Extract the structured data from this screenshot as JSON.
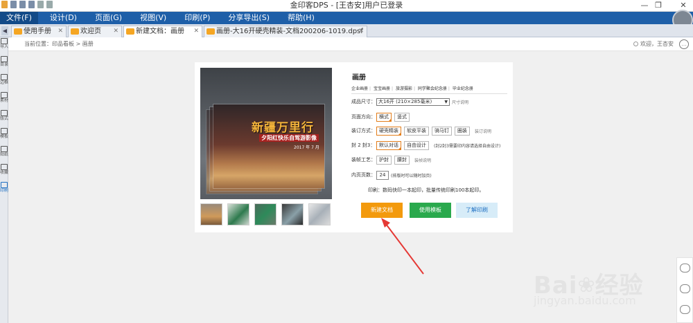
{
  "window": {
    "title": "金印客DPS - [王杏安]用户已登录",
    "controls": [
      "—",
      "❐",
      "✕"
    ]
  },
  "menu": {
    "items": [
      "文件(F)",
      "设计(D)",
      "页面(G)",
      "视图(V)",
      "印刷(P)",
      "分享导出(S)",
      "帮助(H)"
    ],
    "active_index": 0
  },
  "tabs": [
    {
      "label": "使用手册"
    },
    {
      "label": "欢迎页"
    },
    {
      "label": "新建文档：画册",
      "active": true
    },
    {
      "label": "画册-大16开硬壳精装-文档200206-1019.dpsf"
    }
  ],
  "rail": [
    {
      "label": "导入",
      "icon": "import-icon"
    },
    {
      "label": "目录",
      "icon": "catalog-icon"
    },
    {
      "label": "边框",
      "icon": "border-icon"
    },
    {
      "label": "素材",
      "icon": "material-icon"
    },
    {
      "label": "版式",
      "icon": "layout-icon"
    },
    {
      "label": "模板",
      "icon": "template-icon"
    },
    {
      "label": "贴纸",
      "icon": "sticker-icon"
    },
    {
      "label": "收藏",
      "icon": "star-icon"
    },
    {
      "label": "印刷",
      "icon": "print-icon",
      "active": true
    }
  ],
  "breadcrumb": "当前位置：印品看板 > 画册",
  "welcome": "欢迎，王杏安",
  "product": {
    "title": "画册",
    "subtabs": [
      "企业画册",
      "宝宝画册",
      "旅游摄影",
      "同学聚会纪念册",
      "毕业纪念册"
    ],
    "size_label": "成品尺寸：",
    "size_value": "大16开 (210×285毫米)",
    "size_hint": "尺寸说明",
    "orientation_label": "页面方向：",
    "orientation_options": [
      "横式",
      "竖式"
    ],
    "binding_label": "装订方式：",
    "binding_options": [
      "硬壳精装",
      "软皮平装",
      "骑马钉",
      "圈装"
    ],
    "binding_hint": "装订说明",
    "cover_label": "封 2 封3：",
    "cover_options": [
      "默认对话",
      "自由设计"
    ],
    "cover_hint": "(封2封3需要印内容请选择自由设计)",
    "craft_label": "装帧工艺：",
    "craft_options": [
      "护封",
      "腰封"
    ],
    "craft_hint": "装帧说明",
    "pages_label": "内页页数：",
    "pages_value": "24",
    "pages_hint": "(排版时可以随时加页)",
    "print_note": "印刷：数码快印一本起印，批量传统印刷100本起印。",
    "buttons": {
      "new": "新建文档",
      "template": "使用模板",
      "learn": "了解印刷"
    }
  },
  "cover_art": {
    "title": "新疆万里行",
    "subtitle": "夕阳红快乐自驾游影像",
    "date": "2017 年 7 月"
  },
  "colors": {
    "menu_bg": "#1e5fa8",
    "accent_orange": "#f39a0d",
    "accent_green": "#2aa94d",
    "annotation_red": "#e53935"
  },
  "watermark": {
    "brand": "Bai",
    "brand_tail": "经验",
    "url": "jingyan.baidu.com"
  }
}
